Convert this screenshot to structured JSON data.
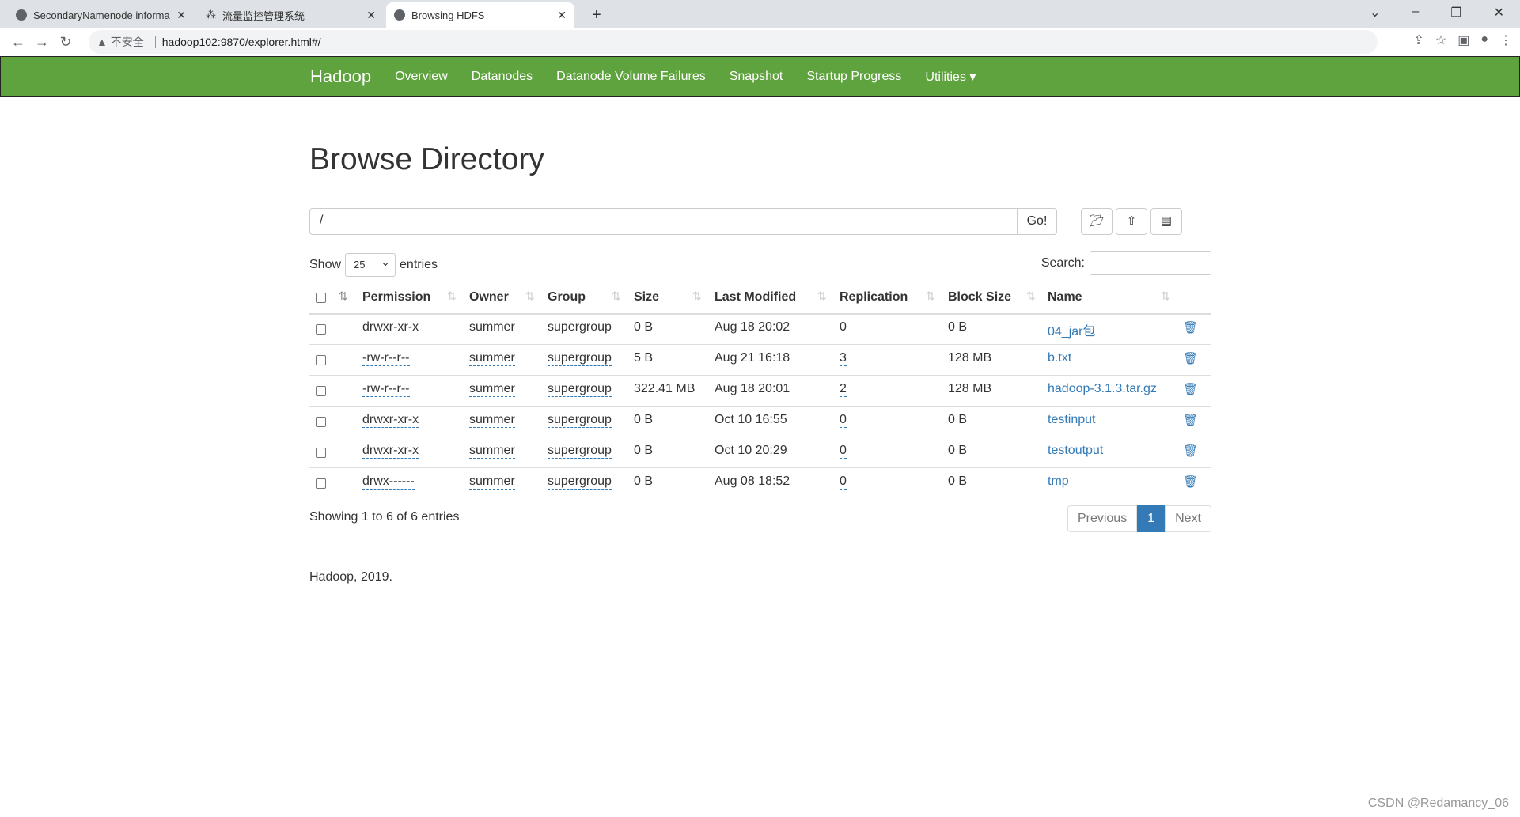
{
  "browser": {
    "tabs": [
      {
        "title": "SecondaryNamenode informa"
      },
      {
        "title": "流量监控管理系统"
      },
      {
        "title": "Browsing HDFS"
      }
    ],
    "security": "不安全",
    "url": "hadoop102:9870/explorer.html#/"
  },
  "navbar": {
    "brand": "Hadoop",
    "links": [
      "Overview",
      "Datanodes",
      "Datanode Volume Failures",
      "Snapshot",
      "Startup Progress",
      "Utilities ▾"
    ]
  },
  "page": {
    "title": "Browse Directory",
    "path": "/",
    "go": "Go!",
    "show": "Show",
    "entries_value": "25",
    "entries": "entries",
    "search": "Search:"
  },
  "table": {
    "headers": [
      "Permission",
      "Owner",
      "Group",
      "Size",
      "Last Modified",
      "Replication",
      "Block Size",
      "Name"
    ],
    "rows": [
      [
        "drwxr-xr-x",
        "summer",
        "supergroup",
        "0 B",
        "Aug 18 20:02",
        "0",
        "0 B",
        "04_jar包"
      ],
      [
        "-rw-r--r--",
        "summer",
        "supergroup",
        "5 B",
        "Aug 21 16:18",
        "3",
        "128 MB",
        "b.txt"
      ],
      [
        "-rw-r--r--",
        "summer",
        "supergroup",
        "322.41 MB",
        "Aug 18 20:01",
        "2",
        "128 MB",
        "hadoop-3.1.3.tar.gz"
      ],
      [
        "drwxr-xr-x",
        "summer",
        "supergroup",
        "0 B",
        "Oct 10 16:55",
        "0",
        "0 B",
        "testinput"
      ],
      [
        "drwxr-xr-x",
        "summer",
        "supergroup",
        "0 B",
        "Oct 10 20:29",
        "0",
        "0 B",
        "testoutput"
      ],
      [
        "drwx------",
        "summer",
        "supergroup",
        "0 B",
        "Aug 08 18:52",
        "0",
        "0 B",
        "tmp"
      ]
    ]
  },
  "footer": {
    "showing": "Showing 1 to 6 of 6 entries",
    "prev": "Previous",
    "page": "1",
    "next": "Next",
    "copyright": "Hadoop, 2019."
  },
  "watermark": "CSDN @Redamancy_06"
}
